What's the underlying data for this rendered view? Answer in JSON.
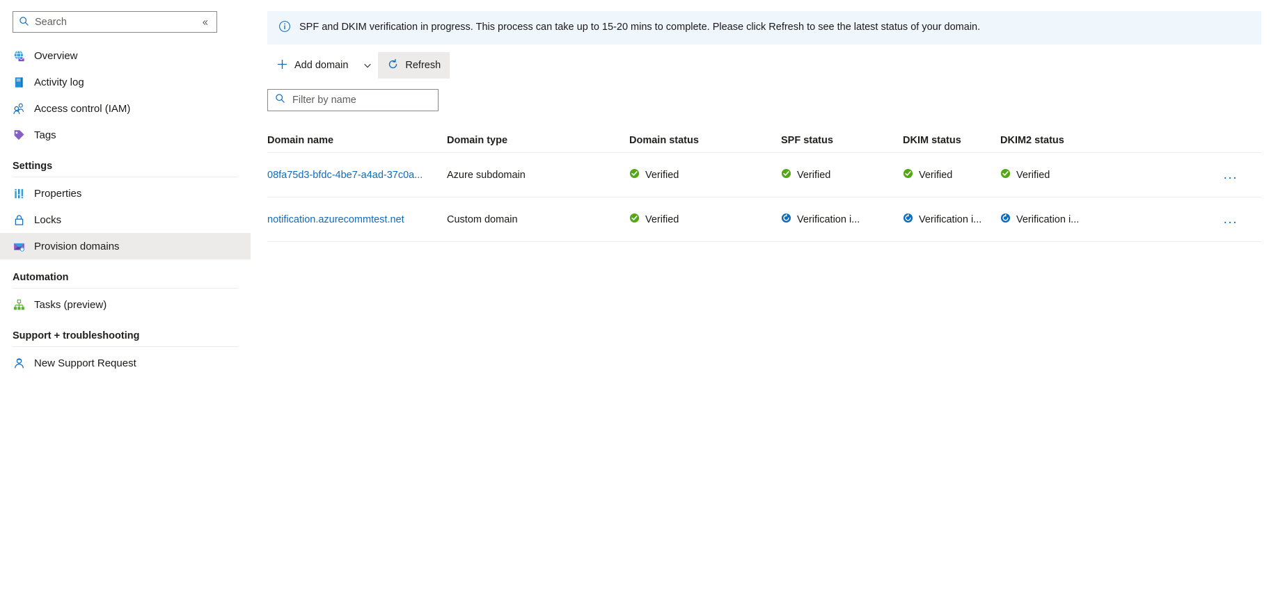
{
  "sidebar": {
    "search": {
      "placeholder": "Search",
      "icon": "search-icon"
    },
    "collapse": {
      "icon": "double-chevron-left-icon",
      "label": "«"
    },
    "items": [
      {
        "label": "Overview",
        "icon": "overview-globe-icon"
      },
      {
        "label": "Activity log",
        "icon": "activity-log-icon"
      },
      {
        "label": "Access control (IAM)",
        "icon": "access-control-people-icon"
      },
      {
        "label": "Tags",
        "icon": "tags-icon"
      }
    ],
    "groups": [
      {
        "title": "Settings",
        "items": [
          {
            "label": "Properties",
            "icon": "properties-bars-icon"
          },
          {
            "label": "Locks",
            "icon": "lock-icon"
          },
          {
            "label": "Provision domains",
            "icon": "provision-domains-envelope-icon",
            "selected": true
          }
        ]
      },
      {
        "title": "Automation",
        "items": [
          {
            "label": "Tasks (preview)",
            "icon": "tasks-hierarchy-icon"
          }
        ]
      },
      {
        "title": "Support + troubleshooting",
        "items": [
          {
            "label": "New Support Request",
            "icon": "support-person-icon"
          }
        ]
      }
    ]
  },
  "banner": {
    "icon": "info-circle-icon",
    "text": "SPF and DKIM verification in progress. This process can take up to 15-20 mins to complete. Please click Refresh to see the latest status of your domain."
  },
  "toolbar": {
    "add_domain_label": "Add domain",
    "add_domain_icon": "plus-icon",
    "add_domain_caret_icon": "chevron-down-icon",
    "refresh_label": "Refresh",
    "refresh_icon": "refresh-circular-arrow-icon"
  },
  "filter": {
    "placeholder": "Filter by name",
    "value": "",
    "icon": "search-icon"
  },
  "table": {
    "columns": [
      "Domain name",
      "Domain type",
      "Domain status",
      "SPF status",
      "DKIM status",
      "DKIM2 status"
    ],
    "rows": [
      {
        "name": "08fa75d3-bfdc-4be7-a4ad-37c0a...",
        "type": "Azure subdomain",
        "domain_status": {
          "text": "Verified",
          "state": "verified"
        },
        "spf_status": {
          "text": "Verified",
          "state": "verified"
        },
        "dkim_status": {
          "text": "Verified",
          "state": "verified"
        },
        "dkim2_status": {
          "text": "Verified",
          "state": "verified"
        },
        "more_label": "..."
      },
      {
        "name": "notification.azurecommtest.net",
        "type": "Custom domain",
        "domain_status": {
          "text": "Verified",
          "state": "verified"
        },
        "spf_status": {
          "text": "Verification i...",
          "state": "in-progress"
        },
        "dkim_status": {
          "text": "Verification i...",
          "state": "in-progress"
        },
        "dkim2_status": {
          "text": "Verification i...",
          "state": "in-progress"
        },
        "more_label": "..."
      }
    ]
  },
  "colors": {
    "link": "#0f6cbd",
    "verified_green": "#54a818",
    "in_progress_blue": "#0f6cbd",
    "banner_bg": "#eff6fc",
    "selected_bg": "#edebe9"
  }
}
